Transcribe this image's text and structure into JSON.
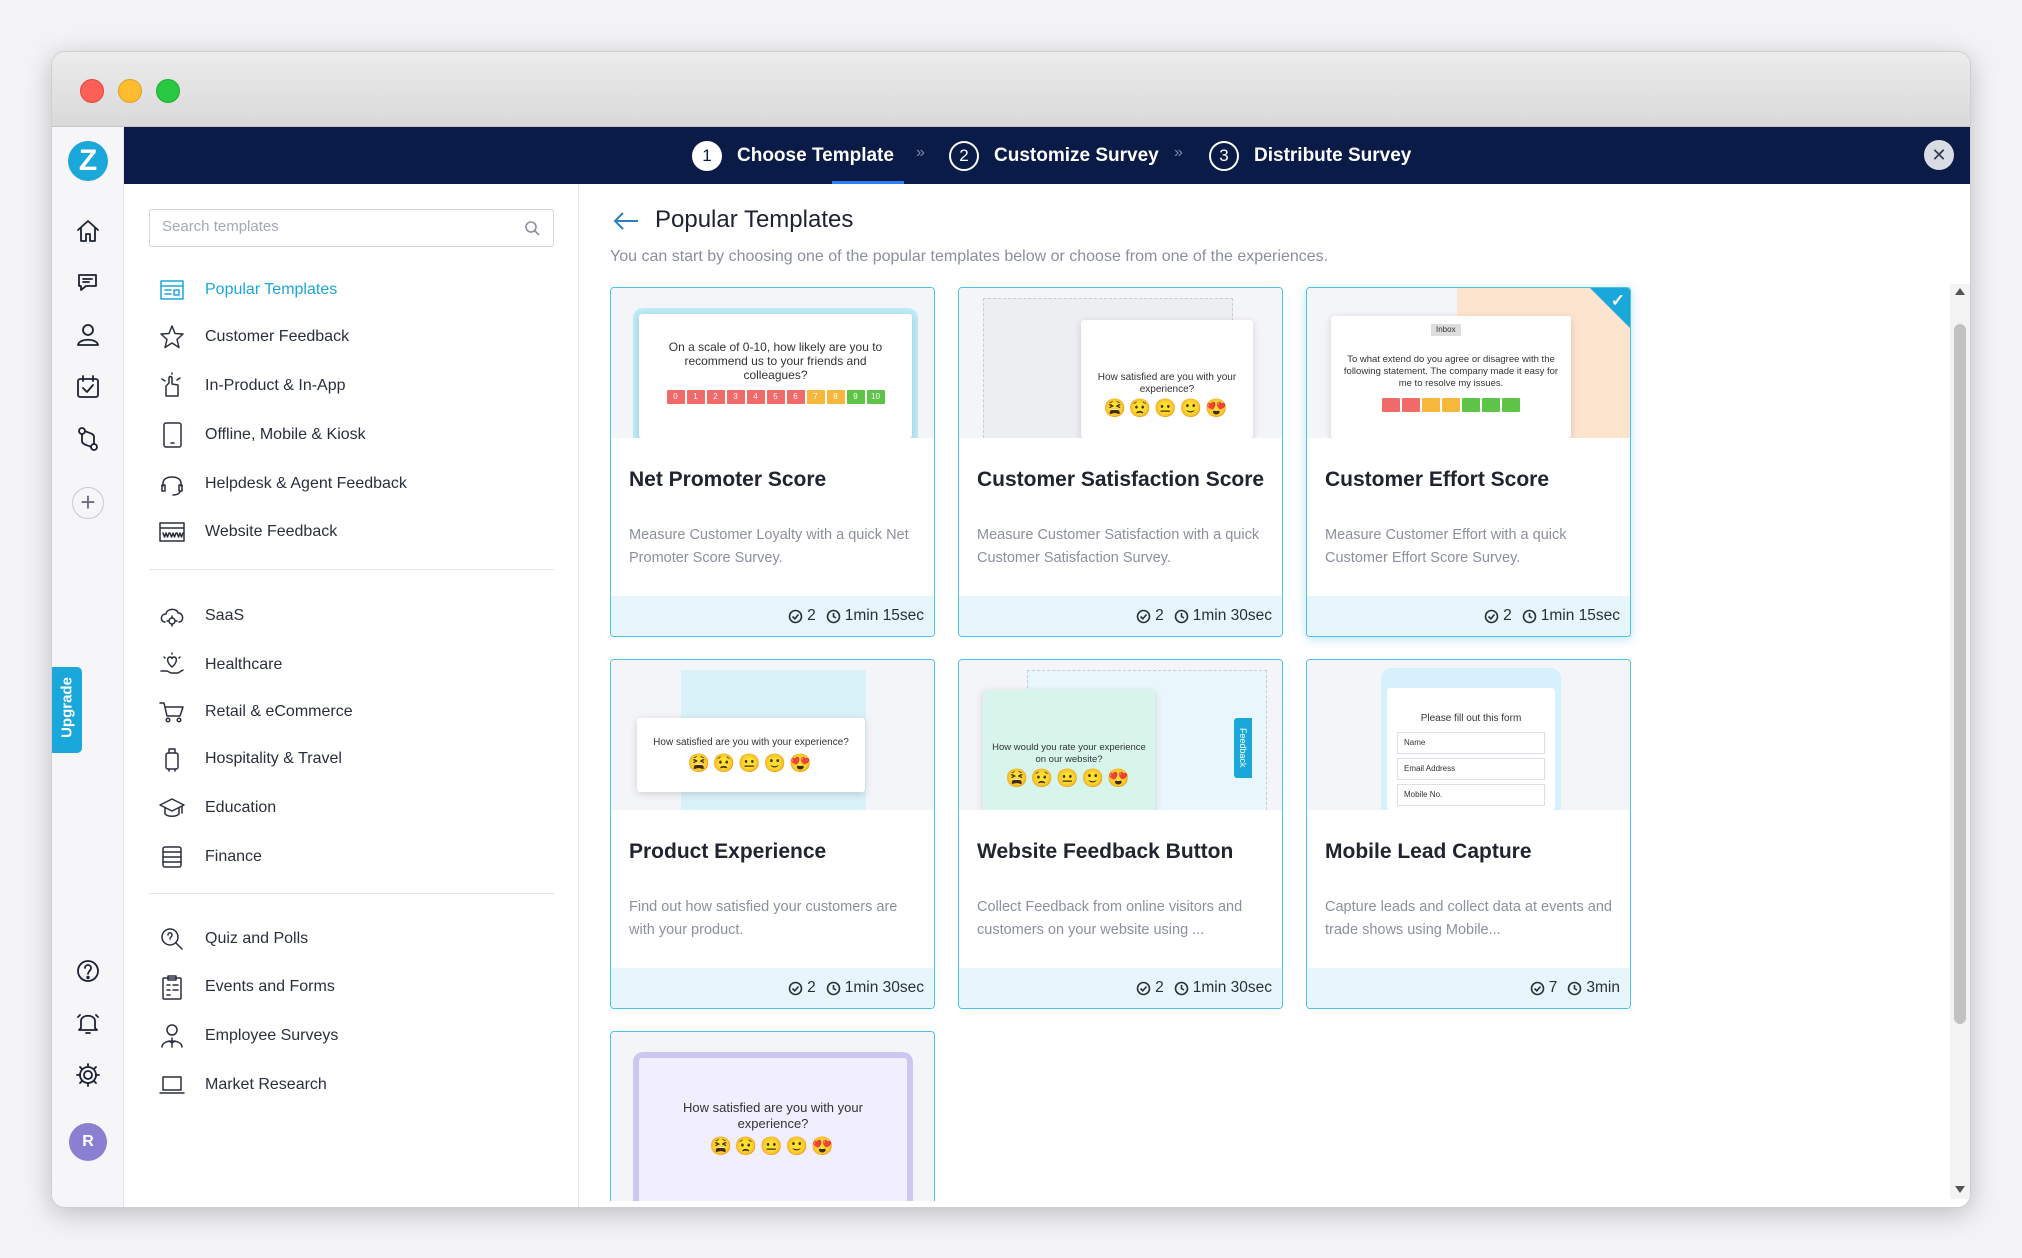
{
  "steps": [
    {
      "num": "1",
      "label": "Choose Template"
    },
    {
      "num": "2",
      "label": "Customize Survey"
    },
    {
      "num": "3",
      "label": "Distribute Survey"
    }
  ],
  "rail": {
    "logo": "Z",
    "upgrade": "Upgrade",
    "avatar": "R"
  },
  "search": {
    "placeholder": "Search templates"
  },
  "sidebar": {
    "group1": [
      {
        "label": "Popular Templates",
        "icon": "popular-templates-icon"
      },
      {
        "label": "Customer Feedback",
        "icon": "star-icon"
      },
      {
        "label": "In-Product & In-App",
        "icon": "in-app-icon"
      },
      {
        "label": "Offline, Mobile & Kiosk",
        "icon": "tablet-icon"
      },
      {
        "label": "Helpdesk & Agent Feedback",
        "icon": "headset-icon"
      },
      {
        "label": "Website Feedback",
        "icon": "browser-icon"
      }
    ],
    "group2": [
      {
        "label": "SaaS",
        "icon": "cloud-gear-icon"
      },
      {
        "label": "Healthcare",
        "icon": "heart-hand-icon"
      },
      {
        "label": "Retail & eCommerce",
        "icon": "cart-icon"
      },
      {
        "label": "Hospitality & Travel",
        "icon": "luggage-icon"
      },
      {
        "label": "Education",
        "icon": "graduation-cap-icon"
      },
      {
        "label": "Finance",
        "icon": "coins-icon"
      }
    ],
    "group3": [
      {
        "label": "Quiz and Polls",
        "icon": "quiz-icon"
      },
      {
        "label": "Events and Forms",
        "icon": "clipboard-icon"
      },
      {
        "label": "Employee Surveys",
        "icon": "employee-icon"
      },
      {
        "label": "Market Research",
        "icon": "laptop-icon"
      }
    ]
  },
  "main": {
    "title": "Popular Templates",
    "subtitle": "You can start by choosing one of the popular templates below or choose from one of the experiences."
  },
  "cards": [
    {
      "title": "Net Promoter Score",
      "desc": "Measure Customer Loyalty with a quick Net Promoter Score Survey.",
      "questions": "2",
      "time": "1min 15sec",
      "preview": "On a scale of 0-10, how likely are you to recommend us to your friends and colleagues?",
      "scale": [
        "0",
        "1",
        "2",
        "3",
        "4",
        "5",
        "6",
        "7",
        "8",
        "9",
        "10"
      ]
    },
    {
      "title": "Customer Satisfaction Score",
      "desc": "Measure Customer Satisfaction with a quick Customer Satisfaction Survey.",
      "questions": "2",
      "time": "1min 30sec",
      "preview": "How satisfied are you with your experience?"
    },
    {
      "title": "Customer Effort Score",
      "desc": "Measure Customer Effort with a quick Customer Effort Score Survey.",
      "questions": "2",
      "time": "1min 15sec",
      "preview": "To what extend do you agree or disagree with the following statement. The company made it easy for me to resolve my issues.",
      "tag": "Inbox"
    },
    {
      "title": "Product Experience",
      "desc": "Find out how satisfied your customers are with your product.",
      "questions": "2",
      "time": "1min 30sec",
      "preview": "How satisfied are you with your experience?"
    },
    {
      "title": "Website Feedback Button",
      "desc": "Collect Feedback from online visitors and customers on your website using ...",
      "questions": "2",
      "time": "1min 30sec",
      "preview": "How would you rate your experience on our website?",
      "tab": "Feedback"
    },
    {
      "title": "Mobile Lead Capture",
      "desc": "Capture leads and collect data at events and trade shows using Mobile...",
      "questions": "7",
      "time": "3min",
      "preview": "Please fill out this form",
      "fields": [
        "Name",
        "Email Address",
        "Mobile No."
      ]
    },
    {
      "preview": "How satisfied are you with your experience?"
    }
  ],
  "colors": {
    "accent": "#1aa7d9",
    "topbar": "#0b1b48",
    "footer": "#e6f6fc"
  }
}
